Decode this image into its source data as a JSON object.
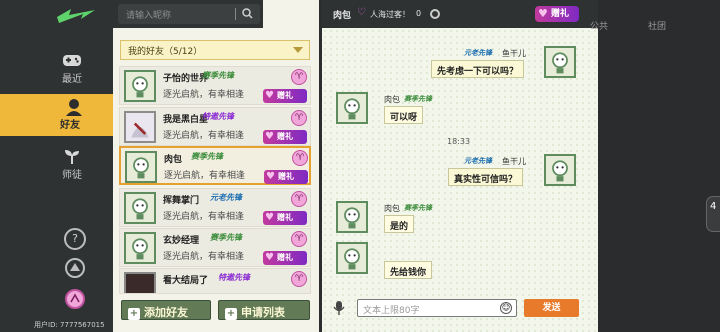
{
  "nav": {
    "items": [
      {
        "label": "最近",
        "icon": "game-controller-icon"
      },
      {
        "label": "好友",
        "icon": "buddy-icon"
      },
      {
        "label": "师徒",
        "icon": "sprout-icon"
      }
    ],
    "help_icon": "?",
    "uid_text": "用户ID: 7777567015"
  },
  "search": {
    "placeholder": "请输入昵称"
  },
  "friends": {
    "group_label": "我的好友（5/12）",
    "items": [
      {
        "name": "子怡的世界",
        "title": "赛季先锋",
        "sig": "逐光启航，有幸相逢",
        "title_color": "green"
      },
      {
        "name": "我是黑白星",
        "title": "特邀先锋",
        "sig": "逐光启航，有幸相逢",
        "title_color": "purple"
      },
      {
        "name": "肉包",
        "title": "赛季先锋",
        "sig": "逐光启航，有幸相逢",
        "title_color": "green"
      },
      {
        "name": "挥舞掌门",
        "title": "元老先锋",
        "sig": "逐光启航，有幸相逢",
        "title_color": "green"
      },
      {
        "name": "玄妙经理",
        "title": "赛季先锋",
        "sig": "逐光启航，有幸相逢",
        "title_color": "green"
      },
      {
        "name": "看大结局了",
        "title": "特邀先锋",
        "sig": "",
        "title_color": "purple"
      }
    ],
    "gift_label": "赠礼",
    "add_label": "添加好友",
    "request_label": "申请列表"
  },
  "chat": {
    "name": "肉包",
    "status": "人海过客！",
    "count": "0",
    "gift_label": "赠礼",
    "messages": [
      {
        "side": "right",
        "name": "鱼干儿",
        "title": "元老先锋",
        "text": "先考虑一下可以吗？"
      },
      {
        "side": "left",
        "name": "肉包",
        "title": "赛季先锋",
        "text": "可以呀"
      },
      {
        "side": "right",
        "name": "鱼干儿",
        "title": "元老先锋",
        "text": "真实性可信吗？"
      },
      {
        "side": "left",
        "name": "肉包",
        "title": "赛季先锋",
        "text": "是的"
      },
      {
        "side": "left",
        "name": "",
        "title": "",
        "text": "先给钱你"
      }
    ],
    "timestamp": "18:33",
    "input_placeholder": "文本上限80字",
    "send_label": "发送"
  },
  "right_tabs": [
    "公共",
    "社团"
  ],
  "right_badge": "4"
}
